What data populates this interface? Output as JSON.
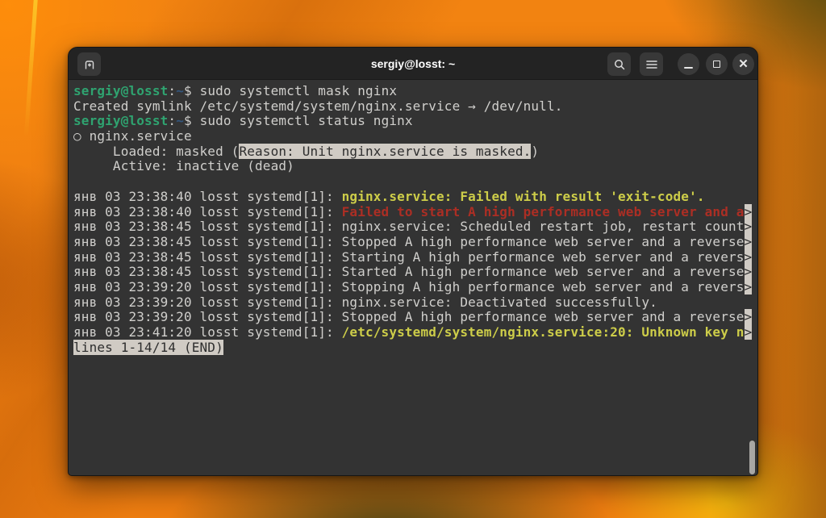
{
  "window": {
    "title": "sergiy@losst: ~",
    "icons": [
      "new-tab-icon",
      "search-icon",
      "menu-icon",
      "minimize-icon",
      "maximize-icon",
      "close-icon"
    ]
  },
  "colors": {
    "terminal_bg": "#333333",
    "headerbar_bg": "#232323",
    "foreground": "#d0cfcc",
    "prompt_user_green": "#2fa370",
    "prompt_path_blue": "#33567d",
    "log_yellow": "#cdcd49",
    "log_red": "#ac2e24",
    "inverse_bg": "#d0cbc4",
    "wallpaper_orange": "#ef7f11"
  },
  "terminal": {
    "pager_status": "lines 1-14/14 (END)",
    "lines": [
      [
        [
          "green",
          "sergiy@losst"
        ],
        [
          "fg",
          ":"
        ],
        [
          "blue",
          "~"
        ],
        [
          "fg",
          "$ sudo systemctl mask nginx"
        ]
      ],
      [
        [
          "fg",
          "Created symlink /etc/systemd/system/nginx.service → /dev/null."
        ]
      ],
      [
        [
          "green",
          "sergiy@losst"
        ],
        [
          "fg",
          ":"
        ],
        [
          "blue",
          "~"
        ],
        [
          "fg",
          "$ sudo systemctl status nginx"
        ]
      ],
      [
        [
          "fg",
          "○ nginx.service"
        ]
      ],
      [
        [
          "fg",
          "     Loaded: masked ("
        ],
        [
          "inv",
          "Reason: Unit nginx.service is masked."
        ],
        [
          "fg",
          ")"
        ]
      ],
      [
        [
          "fg",
          "     Active: inactive (dead)"
        ]
      ],
      [],
      [
        [
          "fg",
          "янв 03 23:38:40 losst systemd[1]: "
        ],
        [
          "yellow",
          "nginx.service: Failed with result 'exit-code'."
        ]
      ],
      [
        [
          "fg",
          "янв 03 23:38:40 losst systemd[1]: "
        ],
        [
          "red",
          "Failed to start A high performance web server and a"
        ],
        [
          "inv",
          ">"
        ]
      ],
      [
        [
          "fg",
          "янв 03 23:38:45 losst systemd[1]: nginx.service: Scheduled restart job, restart count"
        ],
        [
          "inv",
          ">"
        ]
      ],
      [
        [
          "fg",
          "янв 03 23:38:45 losst systemd[1]: Stopped A high performance web server and a reverse"
        ],
        [
          "inv",
          ">"
        ]
      ],
      [
        [
          "fg",
          "янв 03 23:38:45 losst systemd[1]: Starting A high performance web server and a revers"
        ],
        [
          "inv",
          ">"
        ]
      ],
      [
        [
          "fg",
          "янв 03 23:38:45 losst systemd[1]: Started A high performance web server and a reverse"
        ],
        [
          "inv",
          ">"
        ]
      ],
      [
        [
          "fg",
          "янв 03 23:39:20 losst systemd[1]: Stopping A high performance web server and a revers"
        ],
        [
          "inv",
          ">"
        ]
      ],
      [
        [
          "fg",
          "янв 03 23:39:20 losst systemd[1]: nginx.service: Deactivated successfully."
        ]
      ],
      [
        [
          "fg",
          "янв 03 23:39:20 losst systemd[1]: Stopped A high performance web server and a reverse"
        ],
        [
          "inv",
          ">"
        ]
      ],
      [
        [
          "fg",
          "янв 03 23:41:20 losst systemd[1]: "
        ],
        [
          "yellow",
          "/etc/systemd/system/nginx.service:20: Unknown key n"
        ],
        [
          "inv",
          ">"
        ]
      ],
      [
        [
          "inv",
          "lines 1-14/14 (END)"
        ]
      ]
    ]
  }
}
